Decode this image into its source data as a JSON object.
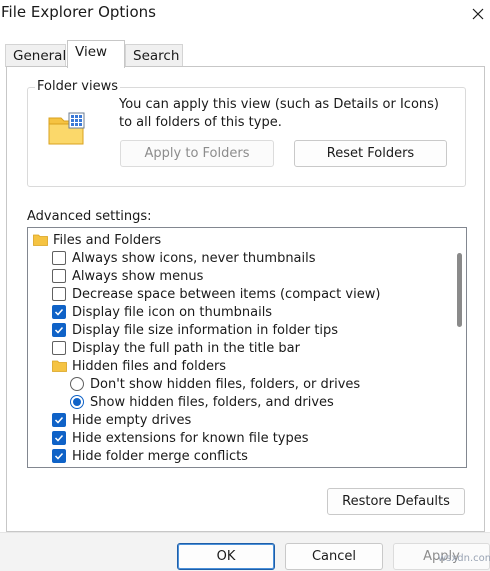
{
  "window": {
    "title": "File Explorer Options"
  },
  "tabs": [
    {
      "label": "General",
      "active": false
    },
    {
      "label": "View",
      "active": true
    },
    {
      "label": "Search",
      "active": false
    }
  ],
  "folder_views": {
    "legend": "Folder views",
    "description": "You can apply this view (such as Details or Icons) to all folders of this type.",
    "apply_button": "Apply to Folders",
    "reset_button": "Reset Folders"
  },
  "advanced": {
    "label": "Advanced settings:",
    "items": [
      {
        "kind": "folder",
        "label": "Files and Folders"
      },
      {
        "kind": "checkbox",
        "label": "Always show icons, never thumbnails",
        "checked": false
      },
      {
        "kind": "checkbox",
        "label": "Always show menus",
        "checked": false
      },
      {
        "kind": "checkbox",
        "label": "Decrease space between items (compact view)",
        "checked": false
      },
      {
        "kind": "checkbox",
        "label": "Display file icon on thumbnails",
        "checked": true
      },
      {
        "kind": "checkbox",
        "label": "Display file size information in folder tips",
        "checked": true
      },
      {
        "kind": "checkbox",
        "label": "Display the full path in the title bar",
        "checked": false
      },
      {
        "kind": "folder",
        "label": "Hidden files and folders"
      },
      {
        "kind": "radio",
        "label": "Don't show hidden files, folders, or drives",
        "checked": false
      },
      {
        "kind": "radio",
        "label": "Show hidden files, folders, and drives",
        "checked": true
      },
      {
        "kind": "checkbox",
        "label": "Hide empty drives",
        "checked": true
      },
      {
        "kind": "checkbox",
        "label": "Hide extensions for known file types",
        "checked": true
      },
      {
        "kind": "checkbox",
        "label": "Hide folder merge conflicts",
        "checked": true
      }
    ]
  },
  "restore_button": "Restore Defaults",
  "footer": {
    "ok": "OK",
    "cancel": "Cancel",
    "apply": "Apply"
  },
  "watermark": "wsxdn.com",
  "colors": {
    "accent": "#0f62c7",
    "folder": "#f5c342"
  }
}
